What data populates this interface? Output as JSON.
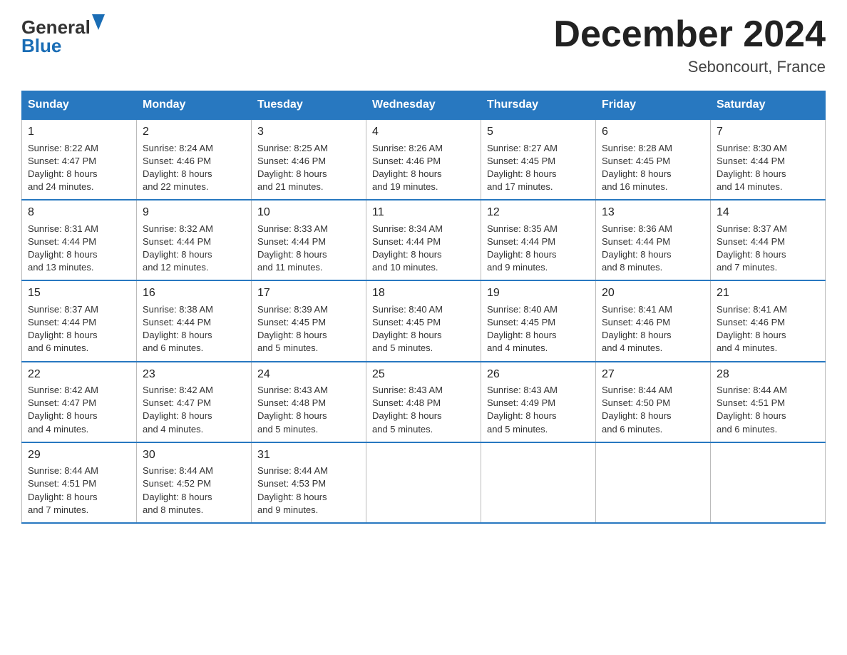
{
  "header": {
    "logo_general": "General",
    "logo_blue": "Blue",
    "title": "December 2024",
    "subtitle": "Seboncourt, France"
  },
  "calendar": {
    "days_of_week": [
      "Sunday",
      "Monday",
      "Tuesday",
      "Wednesday",
      "Thursday",
      "Friday",
      "Saturday"
    ],
    "weeks": [
      [
        {
          "day": "1",
          "sunrise": "8:22 AM",
          "sunset": "4:47 PM",
          "daylight": "8 hours and 24 minutes."
        },
        {
          "day": "2",
          "sunrise": "8:24 AM",
          "sunset": "4:46 PM",
          "daylight": "8 hours and 22 minutes."
        },
        {
          "day": "3",
          "sunrise": "8:25 AM",
          "sunset": "4:46 PM",
          "daylight": "8 hours and 21 minutes."
        },
        {
          "day": "4",
          "sunrise": "8:26 AM",
          "sunset": "4:46 PM",
          "daylight": "8 hours and 19 minutes."
        },
        {
          "day": "5",
          "sunrise": "8:27 AM",
          "sunset": "4:45 PM",
          "daylight": "8 hours and 17 minutes."
        },
        {
          "day": "6",
          "sunrise": "8:28 AM",
          "sunset": "4:45 PM",
          "daylight": "8 hours and 16 minutes."
        },
        {
          "day": "7",
          "sunrise": "8:30 AM",
          "sunset": "4:44 PM",
          "daylight": "8 hours and 14 minutes."
        }
      ],
      [
        {
          "day": "8",
          "sunrise": "8:31 AM",
          "sunset": "4:44 PM",
          "daylight": "8 hours and 13 minutes."
        },
        {
          "day": "9",
          "sunrise": "8:32 AM",
          "sunset": "4:44 PM",
          "daylight": "8 hours and 12 minutes."
        },
        {
          "day": "10",
          "sunrise": "8:33 AM",
          "sunset": "4:44 PM",
          "daylight": "8 hours and 11 minutes."
        },
        {
          "day": "11",
          "sunrise": "8:34 AM",
          "sunset": "4:44 PM",
          "daylight": "8 hours and 10 minutes."
        },
        {
          "day": "12",
          "sunrise": "8:35 AM",
          "sunset": "4:44 PM",
          "daylight": "8 hours and 9 minutes."
        },
        {
          "day": "13",
          "sunrise": "8:36 AM",
          "sunset": "4:44 PM",
          "daylight": "8 hours and 8 minutes."
        },
        {
          "day": "14",
          "sunrise": "8:37 AM",
          "sunset": "4:44 PM",
          "daylight": "8 hours and 7 minutes."
        }
      ],
      [
        {
          "day": "15",
          "sunrise": "8:37 AM",
          "sunset": "4:44 PM",
          "daylight": "8 hours and 6 minutes."
        },
        {
          "day": "16",
          "sunrise": "8:38 AM",
          "sunset": "4:44 PM",
          "daylight": "8 hours and 6 minutes."
        },
        {
          "day": "17",
          "sunrise": "8:39 AM",
          "sunset": "4:45 PM",
          "daylight": "8 hours and 5 minutes."
        },
        {
          "day": "18",
          "sunrise": "8:40 AM",
          "sunset": "4:45 PM",
          "daylight": "8 hours and 5 minutes."
        },
        {
          "day": "19",
          "sunrise": "8:40 AM",
          "sunset": "4:45 PM",
          "daylight": "8 hours and 4 minutes."
        },
        {
          "day": "20",
          "sunrise": "8:41 AM",
          "sunset": "4:46 PM",
          "daylight": "8 hours and 4 minutes."
        },
        {
          "day": "21",
          "sunrise": "8:41 AM",
          "sunset": "4:46 PM",
          "daylight": "8 hours and 4 minutes."
        }
      ],
      [
        {
          "day": "22",
          "sunrise": "8:42 AM",
          "sunset": "4:47 PM",
          "daylight": "8 hours and 4 minutes."
        },
        {
          "day": "23",
          "sunrise": "8:42 AM",
          "sunset": "4:47 PM",
          "daylight": "8 hours and 4 minutes."
        },
        {
          "day": "24",
          "sunrise": "8:43 AM",
          "sunset": "4:48 PM",
          "daylight": "8 hours and 5 minutes."
        },
        {
          "day": "25",
          "sunrise": "8:43 AM",
          "sunset": "4:48 PM",
          "daylight": "8 hours and 5 minutes."
        },
        {
          "day": "26",
          "sunrise": "8:43 AM",
          "sunset": "4:49 PM",
          "daylight": "8 hours and 5 minutes."
        },
        {
          "day": "27",
          "sunrise": "8:44 AM",
          "sunset": "4:50 PM",
          "daylight": "8 hours and 6 minutes."
        },
        {
          "day": "28",
          "sunrise": "8:44 AM",
          "sunset": "4:51 PM",
          "daylight": "8 hours and 6 minutes."
        }
      ],
      [
        {
          "day": "29",
          "sunrise": "8:44 AM",
          "sunset": "4:51 PM",
          "daylight": "8 hours and 7 minutes."
        },
        {
          "day": "30",
          "sunrise": "8:44 AM",
          "sunset": "4:52 PM",
          "daylight": "8 hours and 8 minutes."
        },
        {
          "day": "31",
          "sunrise": "8:44 AM",
          "sunset": "4:53 PM",
          "daylight": "8 hours and 9 minutes."
        },
        null,
        null,
        null,
        null
      ]
    ]
  }
}
